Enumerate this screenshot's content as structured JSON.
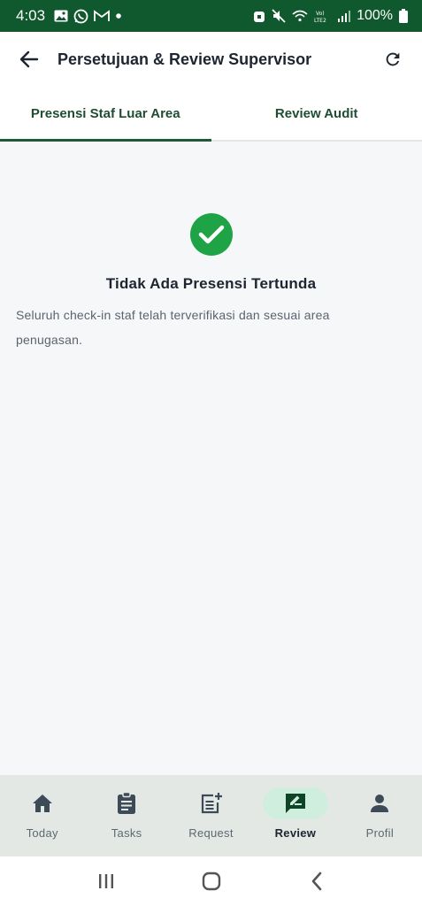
{
  "status_bar": {
    "time": "4:03",
    "battery": "100%",
    "network_label": "Vo) LTE2"
  },
  "app_bar": {
    "title": "Persetujuan & Review Supervisor",
    "back_icon": "arrow-left-icon",
    "refresh_icon": "refresh-icon"
  },
  "tabs": [
    {
      "label": "Presensi Staf Luar Area",
      "active": true
    },
    {
      "label": "Review Audit",
      "active": false
    }
  ],
  "empty_state": {
    "icon": "check-circle-icon",
    "title": "Tidak Ada Presensi Tertunda",
    "description": "Seluruh check-in staf telah terverifikasi dan sesuai area penugasan."
  },
  "bottom_nav": [
    {
      "label": "Today",
      "icon": "home-icon",
      "active": false
    },
    {
      "label": "Tasks",
      "icon": "clipboard-icon",
      "active": false
    },
    {
      "label": "Request",
      "icon": "post-add-icon",
      "active": false
    },
    {
      "label": "Review",
      "icon": "rate-review-icon",
      "active": true
    },
    {
      "label": "Profil",
      "icon": "person-icon",
      "active": false
    }
  ],
  "colors": {
    "primary": "#10592f",
    "accent": "#1e5a38",
    "success": "#1ea446",
    "nav_active_pill": "#cfeedd"
  }
}
